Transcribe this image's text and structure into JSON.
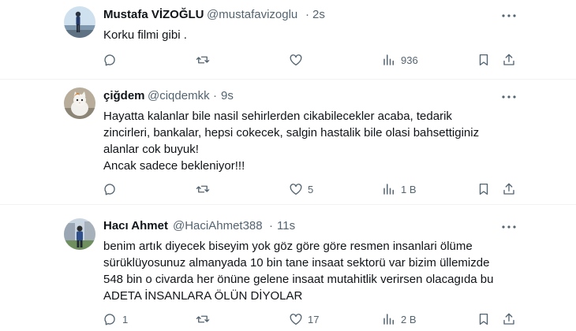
{
  "colors": {
    "text": "#0f1419",
    "secondary": "#536471",
    "divider": "#eff3f4"
  },
  "tweets": [
    {
      "name": "Mustafa VİZOĞLU",
      "handle": "@mustafavizoglu",
      "separator": "·",
      "time": "2s",
      "lines": [
        "Korku filmi gibi ."
      ],
      "reply_count": "",
      "retweet_count": "",
      "like_count": "",
      "view_count": "936",
      "avatar_icon": "avatar-person-landscape"
    },
    {
      "name": "çiğdem",
      "handle": "@ciqdemkk",
      "separator": "·",
      "time": "9s",
      "lines": [
        "Hayatta kalanlar bile nasil sehirlerden cikabilecekler acaba, tedarik",
        "zincirleri, bankalar, hepsi cokecek, salgin hastalik bile olasi bahsettiginiz",
        "alanlar cok buyuk!",
        "Ancak sadece bekleniyor!!!"
      ],
      "reply_count": "",
      "retweet_count": "",
      "like_count": "5",
      "view_count": "1 B",
      "avatar_icon": "avatar-cat"
    },
    {
      "name": "Hacı Ahmet",
      "handle": "@HaciAhmet388",
      "separator": "·",
      "time": "11s",
      "lines": [
        "benim artık diyecek biseyim yok göz göre göre resmen insanlari ölüme",
        "sürüklüyosunuz almanyada 10 bin tane insaat sektorü var bizim üllemizde",
        "548 bin o civarda her önüne gelene insaat mutahitlik verirsen olacagıda bu",
        "ADETA İNSANLARA ÖLÜN DİYOLAR"
      ],
      "reply_count": "1",
      "retweet_count": "",
      "like_count": "17",
      "view_count": "2 B",
      "avatar_icon": "avatar-person-building"
    }
  ]
}
